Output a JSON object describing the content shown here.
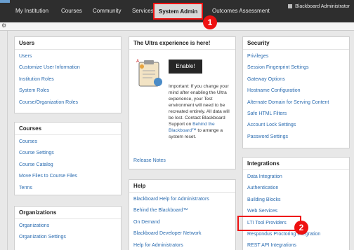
{
  "nav": {
    "tabs": [
      "My Institution",
      "Courses",
      "Community",
      "Services",
      "System Admin",
      "Outcomes Assessment"
    ],
    "user": "Blackboard Administrator"
  },
  "modules": {
    "users": {
      "title": "Users",
      "items": [
        "Users",
        "Customize User Information",
        "Institution Roles",
        "System Roles",
        "Course/Organization Roles"
      ]
    },
    "courses": {
      "title": "Courses",
      "items": [
        "Courses",
        "Course Settings",
        "Course Catalog",
        "Move Files to Course Files",
        "Terms"
      ]
    },
    "organizations": {
      "title": "Organizations",
      "items": [
        "Organizations",
        "Organization Settings"
      ]
    },
    "ultra": {
      "title": "The Ultra experience is here!",
      "button": "Enable!",
      "text_before": "Important: If you change your mind after enabling the Ultra experience, your Test environment will need to be recreated entirely. All data will be lost. Contact Blackboard Support on ",
      "link": "Behind the Blackboard™",
      "text_after": " to arrange a system reset.",
      "release_notes": "Release Notes"
    },
    "help": {
      "title": "Help",
      "items": [
        "Blackboard Help for Administrators",
        "Behind the Blackboard™",
        "On Demand",
        "Blackboard Developer Network",
        "Help for Administrators"
      ]
    },
    "security": {
      "title": "Security",
      "items": [
        "Privileges",
        "Session Fingerprint Settings",
        "Gateway Options",
        "Hostname Configuration",
        "Alternate Domain for Serving Content",
        "Safe HTML Filters",
        "Account Lock Settings",
        "Password Settings"
      ]
    },
    "integrations": {
      "title": "Integrations",
      "items": [
        "Data Integration",
        "Authentication",
        "Building Blocks",
        "Web Services",
        "LTI Tool Providers",
        "Respondus Proctoring Integration",
        "REST API Integrations"
      ]
    }
  },
  "annotations": {
    "step1": "1",
    "step2": "2"
  }
}
